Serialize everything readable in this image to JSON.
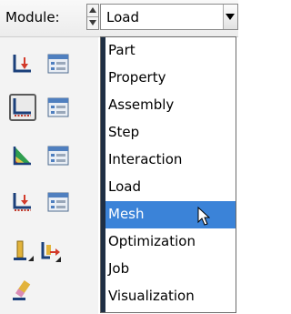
{
  "module_selector": {
    "label": "Module:",
    "value": "Load"
  },
  "module_menu": {
    "items": [
      "Part",
      "Property",
      "Assembly",
      "Step",
      "Interaction",
      "Load",
      "Mesh",
      "Optimization",
      "Job",
      "Visualization"
    ],
    "highlighted": "Mesh"
  },
  "colors": {
    "highlight": "#3b83d8",
    "menu_stripe": "#1f2f44"
  }
}
